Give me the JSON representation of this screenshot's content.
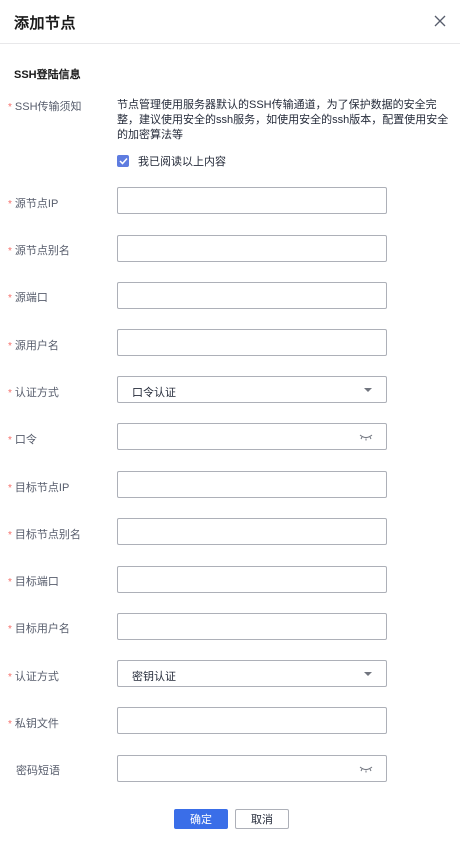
{
  "dialog": {
    "title": "添加节点",
    "close_icon": "close-icon"
  },
  "section": {
    "title": "SSH登陆信息"
  },
  "notice": {
    "label": "SSH传输须知",
    "text": "节点管理使用服务器默认的SSH传输通道，为了保护数据的安全完整，建议使用安全的ssh服务，如使用安全的ssh版本，配置使用安全的加密算法等",
    "checkbox_label": "我已阅读以上内容",
    "checked": true
  },
  "fields": {
    "source_ip": {
      "label": "源节点IP",
      "value": ""
    },
    "source_alias": {
      "label": "源节点别名",
      "value": ""
    },
    "source_port": {
      "label": "源端口",
      "value": ""
    },
    "source_user": {
      "label": "源用户名",
      "value": ""
    },
    "source_auth": {
      "label": "认证方式",
      "value": "口令认证"
    },
    "password": {
      "label": "口令",
      "value": "",
      "icon": "eye-closed-icon"
    },
    "target_ip": {
      "label": "目标节点IP",
      "value": ""
    },
    "target_alias": {
      "label": "目标节点别名",
      "value": ""
    },
    "target_port": {
      "label": "目标端口",
      "value": ""
    },
    "target_user": {
      "label": "目标用户名",
      "value": ""
    },
    "target_auth": {
      "label": "认证方式",
      "value": "密钥认证"
    },
    "private_key": {
      "label": "私钥文件",
      "value": ""
    },
    "passphrase": {
      "label": "密码短语",
      "value": "",
      "icon": "eye-closed-icon"
    }
  },
  "required_mark": "*",
  "footer": {
    "confirm_label": "确定",
    "cancel_label": "取消"
  },
  "colors": {
    "primary": "#3a6ee8",
    "required": "#f66f6a",
    "checkbox": "#5e7ce0",
    "border": "#adb0b8"
  }
}
